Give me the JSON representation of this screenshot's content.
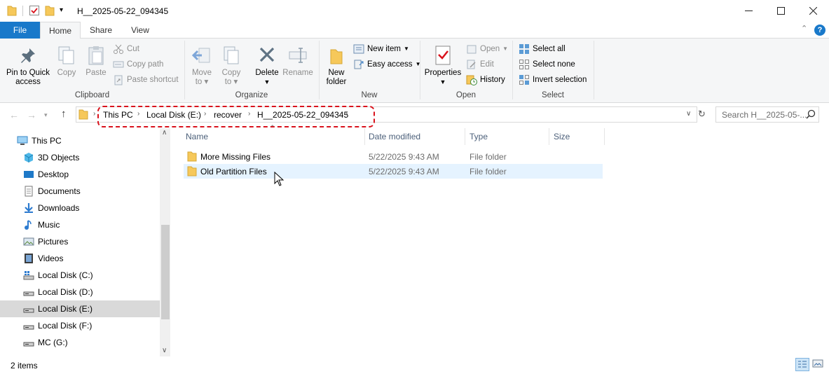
{
  "window": {
    "title": "H__2025-05-22_094345",
    "controls": [
      "minimize",
      "maximize",
      "close"
    ]
  },
  "ribbon": {
    "tabs": [
      {
        "label": "File"
      },
      {
        "label": "Home"
      },
      {
        "label": "Share"
      },
      {
        "label": "View"
      }
    ],
    "active_tab": "Home",
    "clipboard": {
      "group_label": "Clipboard",
      "pin_label_1": "Pin to Quick",
      "pin_label_2": "access",
      "copy_label": "Copy",
      "paste_label": "Paste",
      "cut_label": "Cut",
      "copy_path_label": "Copy path",
      "paste_shortcut_label": "Paste shortcut"
    },
    "organize": {
      "group_label": "Organize",
      "move_label_1": "Move",
      "move_label_2": "to",
      "copy_label_1": "Copy",
      "copy_label_2": "to",
      "delete_label": "Delete",
      "rename_label": "Rename"
    },
    "new": {
      "group_label": "New",
      "new_folder_1": "New",
      "new_folder_2": "folder",
      "new_item_label": "New item",
      "easy_access_label": "Easy access"
    },
    "open": {
      "group_label": "Open",
      "properties_label": "Properties",
      "open_label": "Open",
      "edit_label": "Edit",
      "history_label": "History"
    },
    "select": {
      "group_label": "Select",
      "select_all_label": "Select all",
      "select_none_label": "Select none",
      "invert_label": "Invert selection"
    }
  },
  "address": {
    "crumbs": [
      "This PC",
      "Local Disk (E:)",
      "recover",
      "H__2025-05-22_094345"
    ],
    "search_placeholder": "Search H__2025-05-..."
  },
  "nav_pane": {
    "items": [
      {
        "label": "This PC",
        "icon": "this-pc-icon"
      },
      {
        "label": "3D Objects",
        "icon": "3d-objects-icon"
      },
      {
        "label": "Desktop",
        "icon": "desktop-icon"
      },
      {
        "label": "Documents",
        "icon": "documents-icon"
      },
      {
        "label": "Downloads",
        "icon": "downloads-icon"
      },
      {
        "label": "Music",
        "icon": "music-icon"
      },
      {
        "label": "Pictures",
        "icon": "pictures-icon"
      },
      {
        "label": "Videos",
        "icon": "videos-icon"
      },
      {
        "label": "Local Disk (C:)",
        "icon": "drive-icon"
      },
      {
        "label": "Local Disk (D:)",
        "icon": "drive-icon"
      },
      {
        "label": "Local Disk (E:)",
        "icon": "drive-icon"
      },
      {
        "label": "Local Disk (F:)",
        "icon": "drive-icon"
      },
      {
        "label": "MC (G:)",
        "icon": "drive-icon"
      }
    ],
    "selected": "Local Disk (E:)"
  },
  "file_list": {
    "columns": [
      "Name",
      "Date modified",
      "Type",
      "Size"
    ],
    "rows": [
      {
        "name": "More Missing Files",
        "date": "5/22/2025 9:43 AM",
        "type": "File folder",
        "size": ""
      },
      {
        "name": "Old Partition Files",
        "date": "5/22/2025 9:43 AM",
        "type": "File folder",
        "size": ""
      }
    ]
  },
  "status_bar": {
    "item_count": "2 items"
  },
  "colors": {
    "file_tab": "#1979ca",
    "highlight": "#d9121c",
    "folder": "#f6c85a",
    "selected_nav": "#d9d9d9",
    "hover_row": "#e5f3ff"
  }
}
